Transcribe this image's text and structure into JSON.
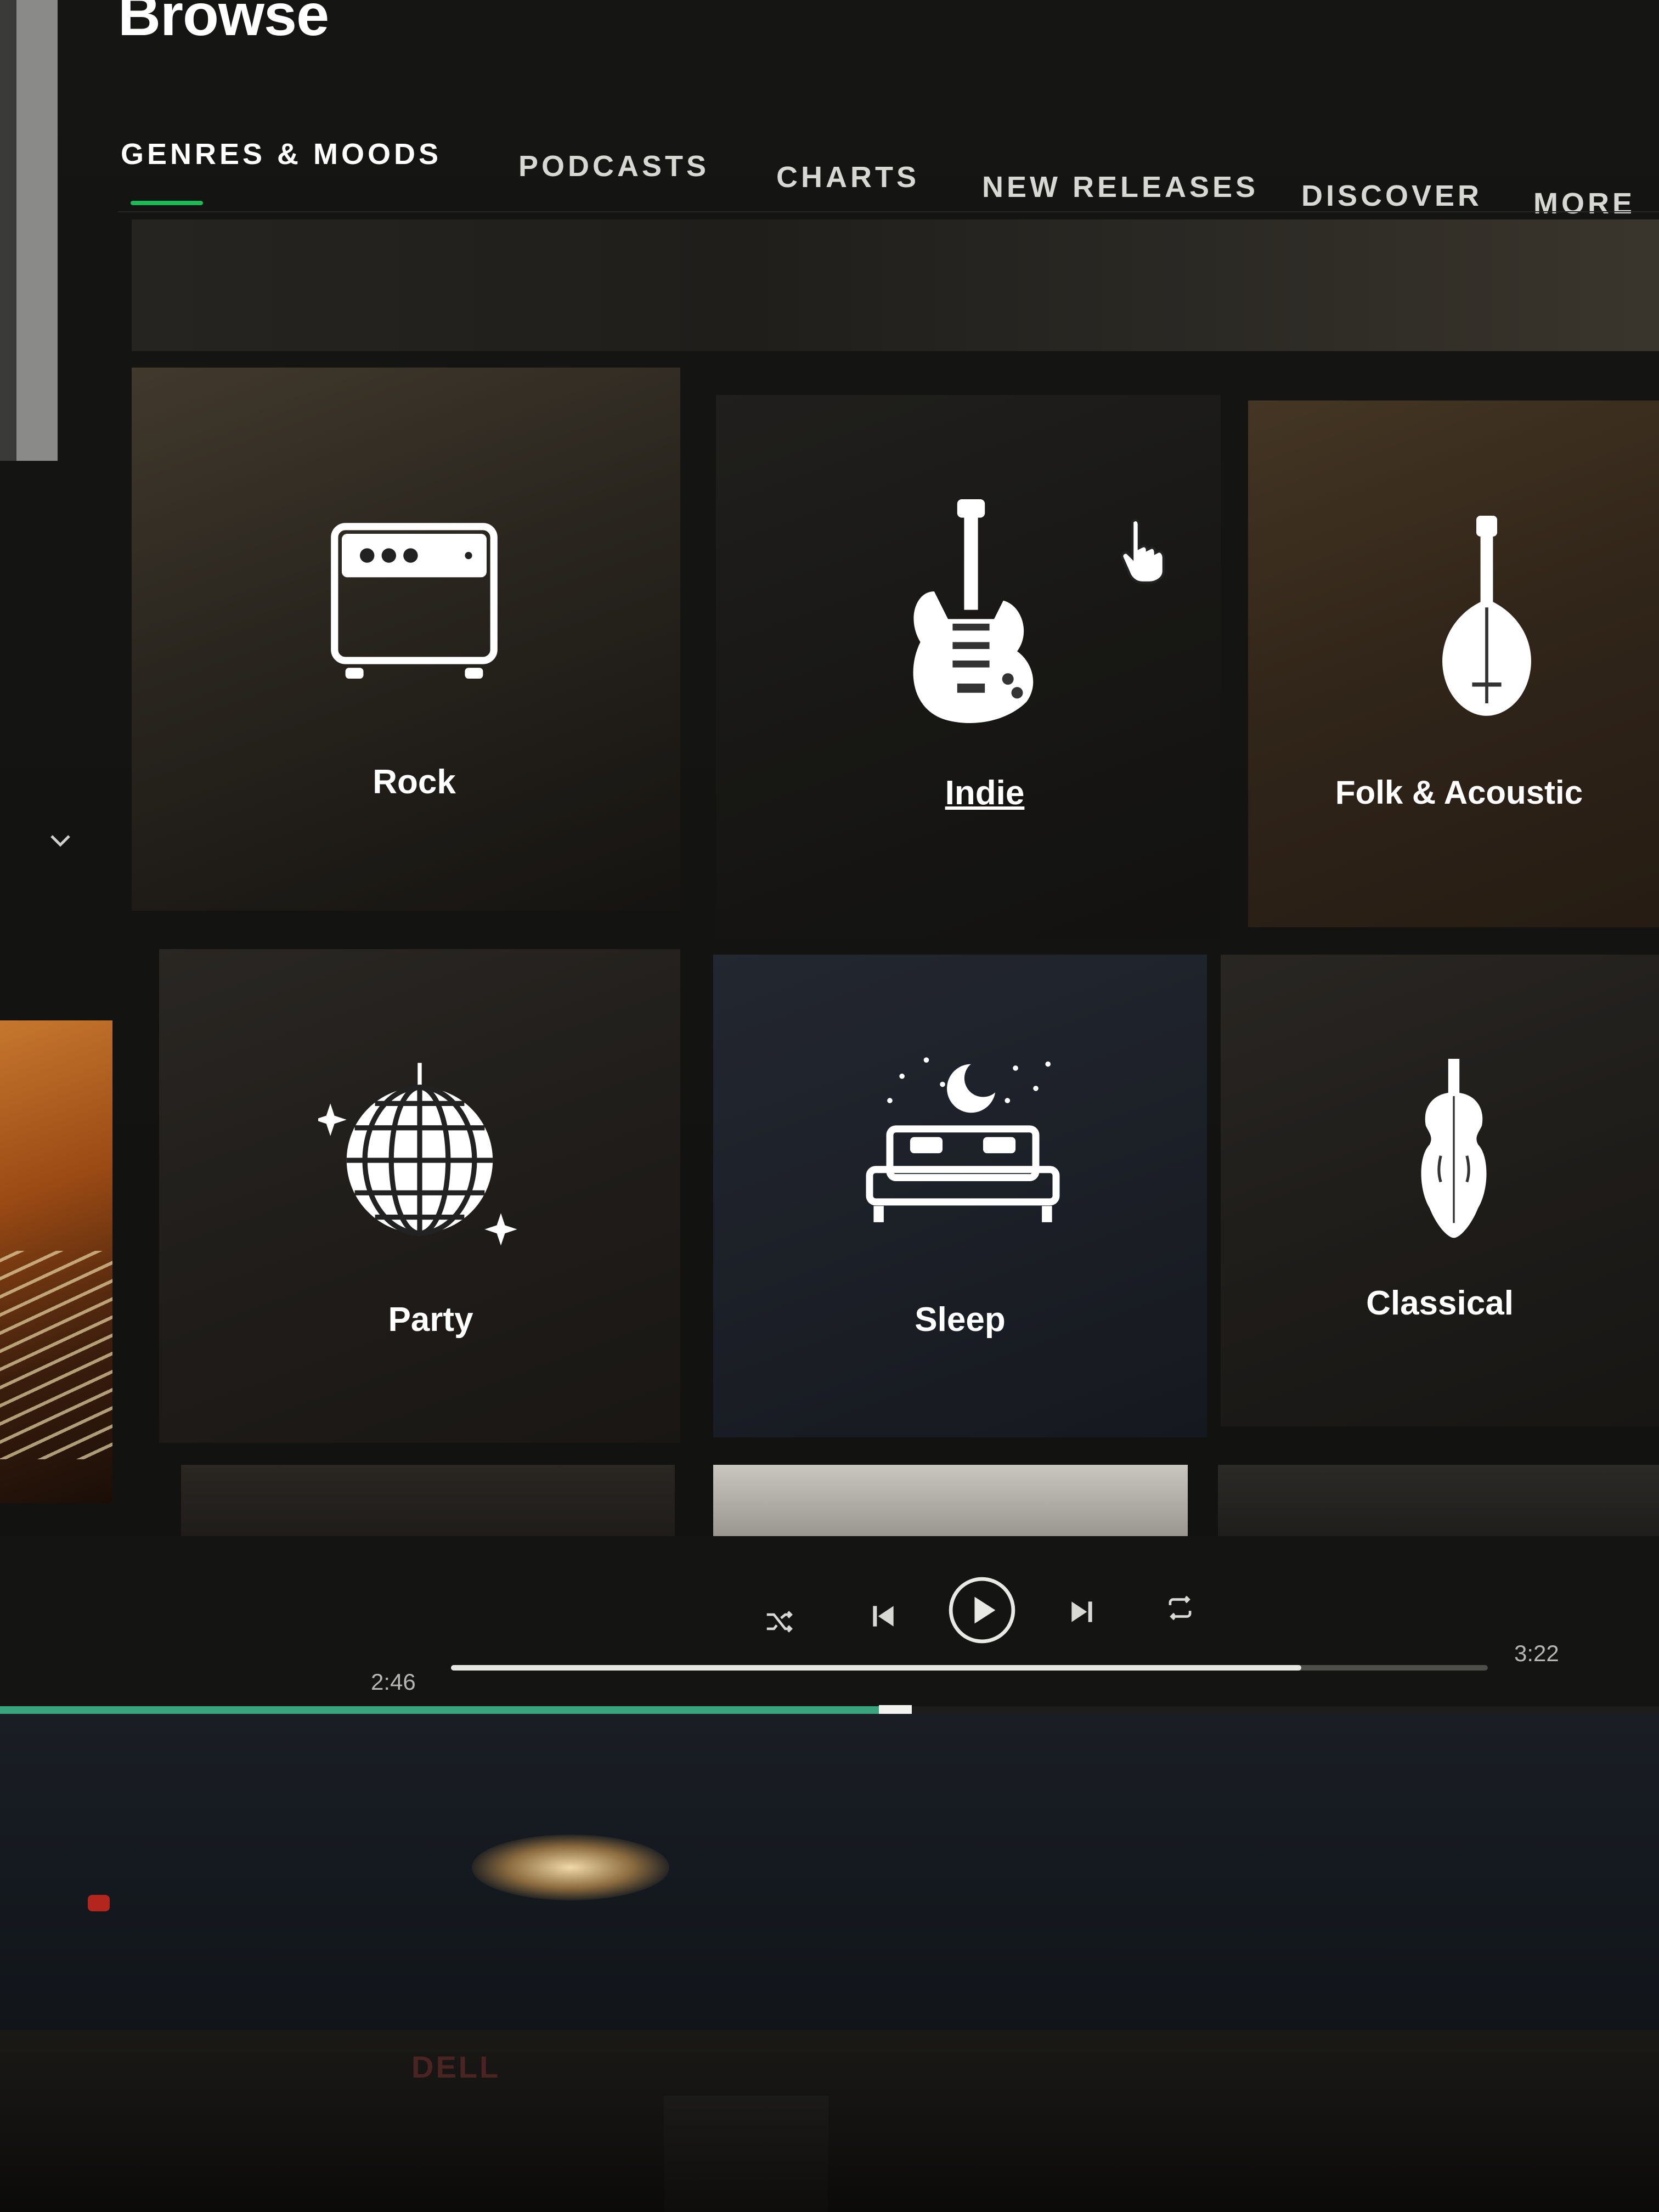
{
  "page": {
    "title": "Browse"
  },
  "tabs": [
    {
      "label": "GENRES & MOODS",
      "active": true
    },
    {
      "label": "PODCASTS",
      "active": false
    },
    {
      "label": "CHARTS",
      "active": false
    },
    {
      "label": "NEW RELEASES",
      "active": false
    },
    {
      "label": "DISCOVER",
      "active": false
    },
    {
      "label": "MORE",
      "active": false
    }
  ],
  "genres": [
    {
      "label": "Rock",
      "icon": "amp-icon"
    },
    {
      "label": "Indie",
      "icon": "electric-guitar-icon",
      "hovered": true
    },
    {
      "label": "Folk & Acoustic",
      "icon": "mandolin-icon"
    },
    {
      "label": "Party",
      "icon": "disco-ball-icon"
    },
    {
      "label": "Sleep",
      "icon": "bed-moon-icon"
    },
    {
      "label": "Classical",
      "icon": "violin-icon"
    }
  ],
  "player": {
    "elapsed": "2:46",
    "duration": "3:22",
    "progress_fraction": 0.82,
    "controls": [
      "shuffle-icon",
      "previous-icon",
      "play-icon",
      "next-icon",
      "repeat-icon"
    ]
  },
  "monitor": {
    "brand": "DELL"
  },
  "colors": {
    "accent": "#1db954",
    "background": "#121212",
    "text": "#ffffff"
  }
}
